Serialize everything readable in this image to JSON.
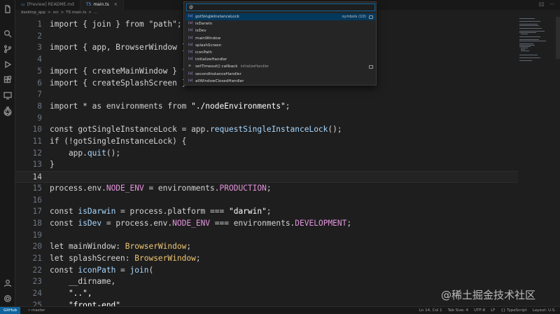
{
  "tabs": [
    {
      "label": "[Preview] README.md",
      "active": false
    },
    {
      "label": "main.ts",
      "active": true
    }
  ],
  "tab_close": "×",
  "breadcrumb": [
    "desktop_app",
    ">",
    "src",
    ">",
    "TS main.ts",
    ">",
    "..."
  ],
  "code": {
    "lines": [
      {
        "n": "1",
        "current": false
      },
      {
        "n": "2",
        "current": false
      },
      {
        "n": "3",
        "current": false
      },
      {
        "n": "4",
        "current": false
      },
      {
        "n": "5",
        "current": false
      },
      {
        "n": "6",
        "current": false
      },
      {
        "n": "7",
        "current": false
      },
      {
        "n": "8",
        "current": false
      },
      {
        "n": "9",
        "current": false
      },
      {
        "n": "10",
        "current": false
      },
      {
        "n": "11",
        "current": false
      },
      {
        "n": "12",
        "current": false
      },
      {
        "n": "13",
        "current": false
      },
      {
        "n": "14",
        "current": true
      },
      {
        "n": "15",
        "current": false
      },
      {
        "n": "16",
        "current": false
      },
      {
        "n": "17",
        "current": false
      },
      {
        "n": "18",
        "current": false
      },
      {
        "n": "19",
        "current": false
      },
      {
        "n": "20",
        "current": false
      },
      {
        "n": "21",
        "current": false
      },
      {
        "n": "22",
        "current": false
      },
      {
        "n": "23",
        "current": false
      },
      {
        "n": "24",
        "current": false
      },
      {
        "n": "25",
        "current": false
      }
    ],
    "text": {
      "l1": "import { join } from \"path\";",
      "l3": "import { app, BrowserWindow }",
      "l5": "import { createMainWindow } f",
      "l6": "import { createSplashScreen }",
      "l8a": "import * as environments from ",
      "l8b": "\"./nodeEnvironments\"",
      "l8c": ";",
      "l10a": "const gotSingleInstanceLock = app.",
      "l10b": "requestSingleInstanceLock",
      "l10c": "();",
      "l11": "if (!gotSingleInstanceLock) {",
      "l12a": "    app.",
      "l12b": "quit",
      "l12c": "();",
      "l13": "}",
      "l15a": "process.env.",
      "l15b": "NODE_ENV",
      "l15c": " = environments.",
      "l15d": "PRODUCTION",
      "l15e": ";",
      "l17a": "const ",
      "l17b": "isDarwin",
      "l17c": " = process.platform === ",
      "l17d": "\"darwin\"",
      "l17e": ";",
      "l18a": "const ",
      "l18b": "isDev",
      "l18c": " = process.env.",
      "l18d": "NODE_ENV",
      "l18e": " === environments.",
      "l18f": "DEVELOPMENT",
      "l18g": ";",
      "l20a": "let mainWindow: ",
      "l20b": "BrowserWindow",
      "l20c": ";",
      "l21a": "let splashScreen: ",
      "l21b": "BrowserWindow",
      "l21c": ";",
      "l22a": "const ",
      "l22b": "iconPath",
      "l22c": " = ",
      "l22d": "join",
      "l22e": "(",
      "l23": "    __dirname,",
      "l24": "    \"..\",",
      "l25": "    \"front-end\","
    }
  },
  "quick_open": {
    "input_value": "@",
    "items": [
      {
        "label": "gotSingleInstanceLock",
        "icon": "[ɑ]",
        "selected": true,
        "right": "symbols (10)"
      },
      {
        "label": "isDarwin",
        "icon": "[ɑ]",
        "selected": false
      },
      {
        "label": "isDev",
        "icon": "[ɑ]",
        "selected": false
      },
      {
        "label": "mainWindow",
        "icon": "[ɑ]",
        "selected": false
      },
      {
        "label": "splashScreen",
        "icon": "[ɑ]",
        "selected": false
      },
      {
        "label": "iconPath",
        "icon": "[ɑ]",
        "selected": false
      },
      {
        "label": "initializeHandler",
        "icon": "[ɑ]",
        "selected": false
      },
      {
        "label": "setTimeout() callback",
        "icon": "⊕",
        "selected": false,
        "desc": "initializeHandler"
      },
      {
        "label": "secondInstanceHandler",
        "icon": "[ɑ]",
        "selected": false
      },
      {
        "label": "allWindowClosedHandler",
        "icon": "[ɑ]",
        "selected": false
      }
    ]
  },
  "statusbar": {
    "remote": "GitHub",
    "branch": "⑂ master",
    "position": "Ln 14, Col 1",
    "tabsize": "Tab Size: 4",
    "encoding": "UTF-8",
    "eol": "LF",
    "language": "{} TypeScript",
    "layout": "Layout: U.S."
  },
  "watermark": "@稀土掘金技术社区",
  "icons": [
    "files-icon",
    "search-icon",
    "source-control-icon",
    "run-debug-icon",
    "extensions-icon",
    "remote-explorer-icon",
    "testing-icon",
    "github-icon",
    "account-icon",
    "settings-gear-icon"
  ]
}
